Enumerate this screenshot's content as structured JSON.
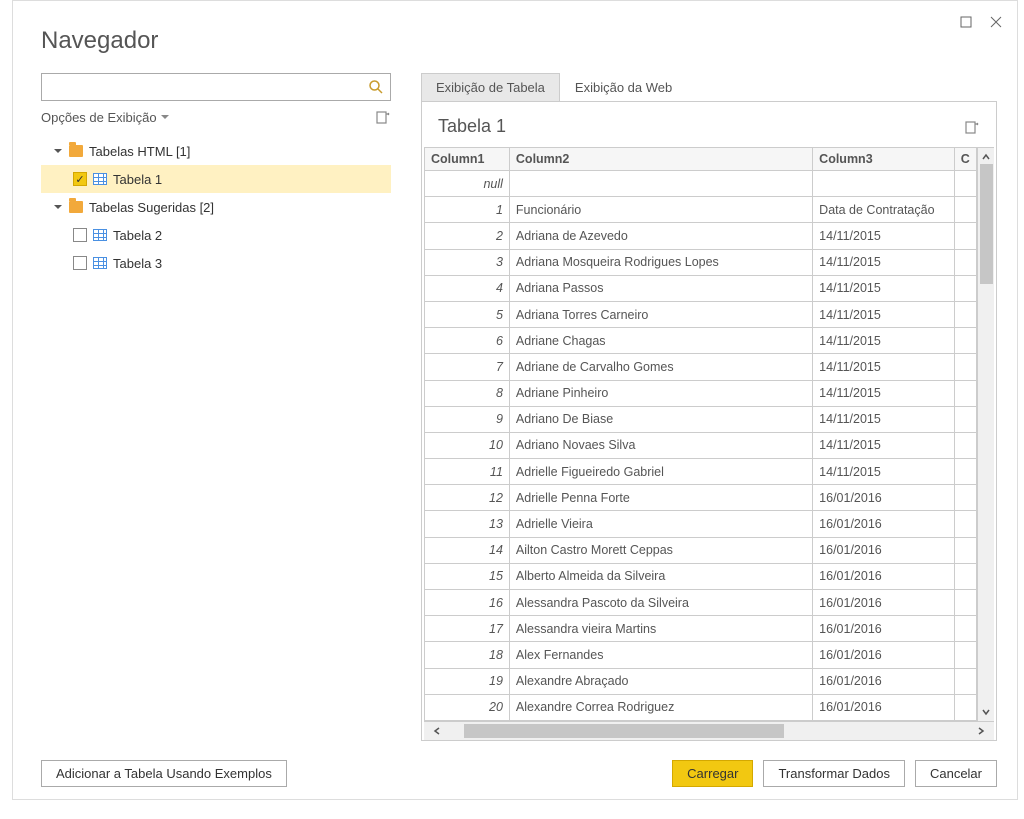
{
  "window": {
    "title": "Navegador"
  },
  "left": {
    "search_placeholder": "",
    "display_options_label": "Opções de Exibição",
    "tree": {
      "group1": {
        "label": "Tabelas HTML [1]"
      },
      "item1": {
        "label": "Tabela 1",
        "checked": true
      },
      "group2": {
        "label": "Tabelas Sugeridas [2]"
      },
      "item2": {
        "label": "Tabela 2",
        "checked": false
      },
      "item3": {
        "label": "Tabela 3",
        "checked": false
      }
    }
  },
  "tabs": {
    "table_view": "Exibição de Tabela",
    "web_view": "Exibição da Web"
  },
  "preview": {
    "title": "Tabela 1",
    "columns": {
      "c1": "Column1",
      "c2": "Column2",
      "c3": "Column3",
      "c4": "C"
    },
    "null_label": "null",
    "rows": [
      {
        "c1": "1",
        "c2": "Funcionário",
        "c3": "Data de Contratação"
      },
      {
        "c1": "2",
        "c2": "Adriana de Azevedo",
        "c3": "14/11/2015"
      },
      {
        "c1": "3",
        "c2": "Adriana Mosqueira Rodrigues Lopes",
        "c3": "14/11/2015"
      },
      {
        "c1": "4",
        "c2": "Adriana Passos",
        "c3": "14/11/2015"
      },
      {
        "c1": "5",
        "c2": "Adriana Torres Carneiro",
        "c3": "14/11/2015"
      },
      {
        "c1": "6",
        "c2": "Adriane Chagas",
        "c3": "14/11/2015"
      },
      {
        "c1": "7",
        "c2": "Adriane de Carvalho Gomes",
        "c3": "14/11/2015"
      },
      {
        "c1": "8",
        "c2": "Adriane Pinheiro",
        "c3": "14/11/2015"
      },
      {
        "c1": "9",
        "c2": "Adriano De Biase",
        "c3": "14/11/2015"
      },
      {
        "c1": "10",
        "c2": "Adriano Novaes Silva",
        "c3": "14/11/2015"
      },
      {
        "c1": "11",
        "c2": "Adrielle Figueiredo Gabriel",
        "c3": "14/11/2015"
      },
      {
        "c1": "12",
        "c2": "Adrielle Penna Forte",
        "c3": "16/01/2016"
      },
      {
        "c1": "13",
        "c2": "Adrielle Vieira",
        "c3": "16/01/2016"
      },
      {
        "c1": "14",
        "c2": "Ailton Castro Morett Ceppas",
        "c3": "16/01/2016"
      },
      {
        "c1": "15",
        "c2": "Alberto Almeida da Silveira",
        "c3": "16/01/2016"
      },
      {
        "c1": "16",
        "c2": "Alessandra Pascoto da Silveira",
        "c3": "16/01/2016"
      },
      {
        "c1": "17",
        "c2": "Alessandra vieira Martins",
        "c3": "16/01/2016"
      },
      {
        "c1": "18",
        "c2": "Alex Fernandes",
        "c3": "16/01/2016"
      },
      {
        "c1": "19",
        "c2": "Alexandre Abraçado",
        "c3": "16/01/2016"
      },
      {
        "c1": "20",
        "c2": "Alexandre Correa Rodriguez",
        "c3": "16/01/2016"
      }
    ]
  },
  "footer": {
    "add_examples": "Adicionar a Tabela Usando Exemplos",
    "load": "Carregar",
    "transform": "Transformar Dados",
    "cancel": "Cancelar"
  }
}
